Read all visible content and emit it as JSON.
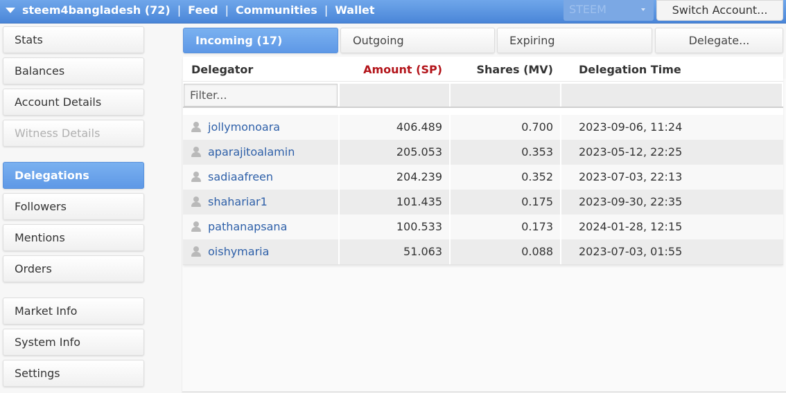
{
  "header": {
    "account_label": "steem4bangladesh (72)",
    "separator": "|",
    "nav": [
      "Feed",
      "Communities",
      "Wallet"
    ],
    "coin_select": "STEEM",
    "switch_account": "Switch Account..."
  },
  "sidebar": {
    "items": [
      {
        "label": "Stats"
      },
      {
        "label": "Balances"
      },
      {
        "label": "Account Details"
      },
      {
        "label": "Witness Details"
      },
      {
        "label": "Delegations"
      },
      {
        "label": "Followers"
      },
      {
        "label": "Mentions"
      },
      {
        "label": "Orders"
      },
      {
        "label": "Market Info"
      },
      {
        "label": "System Info"
      },
      {
        "label": "Settings"
      }
    ]
  },
  "tabs": [
    {
      "label": "Incoming (17)"
    },
    {
      "label": "Outgoing"
    },
    {
      "label": "Expiring"
    },
    {
      "label": "Delegate..."
    }
  ],
  "table": {
    "columns": [
      "Delegator",
      "Amount (SP)",
      "Shares (MV)",
      "Delegation Time"
    ],
    "filter_placeholder": "Filter...",
    "rows": [
      {
        "delegator": "jollymonoara",
        "amount": "406.489",
        "shares": "0.700",
        "time": "2023-09-06, 11:24"
      },
      {
        "delegator": "aparajitoalamin",
        "amount": "205.053",
        "shares": "0.353",
        "time": "2023-05-12, 22:25"
      },
      {
        "delegator": "sadiaafreen",
        "amount": "204.239",
        "shares": "0.352",
        "time": "2023-07-03, 22:13"
      },
      {
        "delegator": "shahariar1",
        "amount": "101.435",
        "shares": "0.175",
        "time": "2023-09-30, 22:35"
      },
      {
        "delegator": "pathanapsana",
        "amount": "100.533",
        "shares": "0.173",
        "time": "2024-01-28, 12:15"
      },
      {
        "delegator": "oishymaria",
        "amount": "51.063",
        "shares": "0.088",
        "time": "2023-07-03, 01:55"
      }
    ]
  },
  "colors": {
    "accent": "#5e98e6",
    "sorted_header": "#b3141a",
    "link": "#2d5fa8"
  }
}
